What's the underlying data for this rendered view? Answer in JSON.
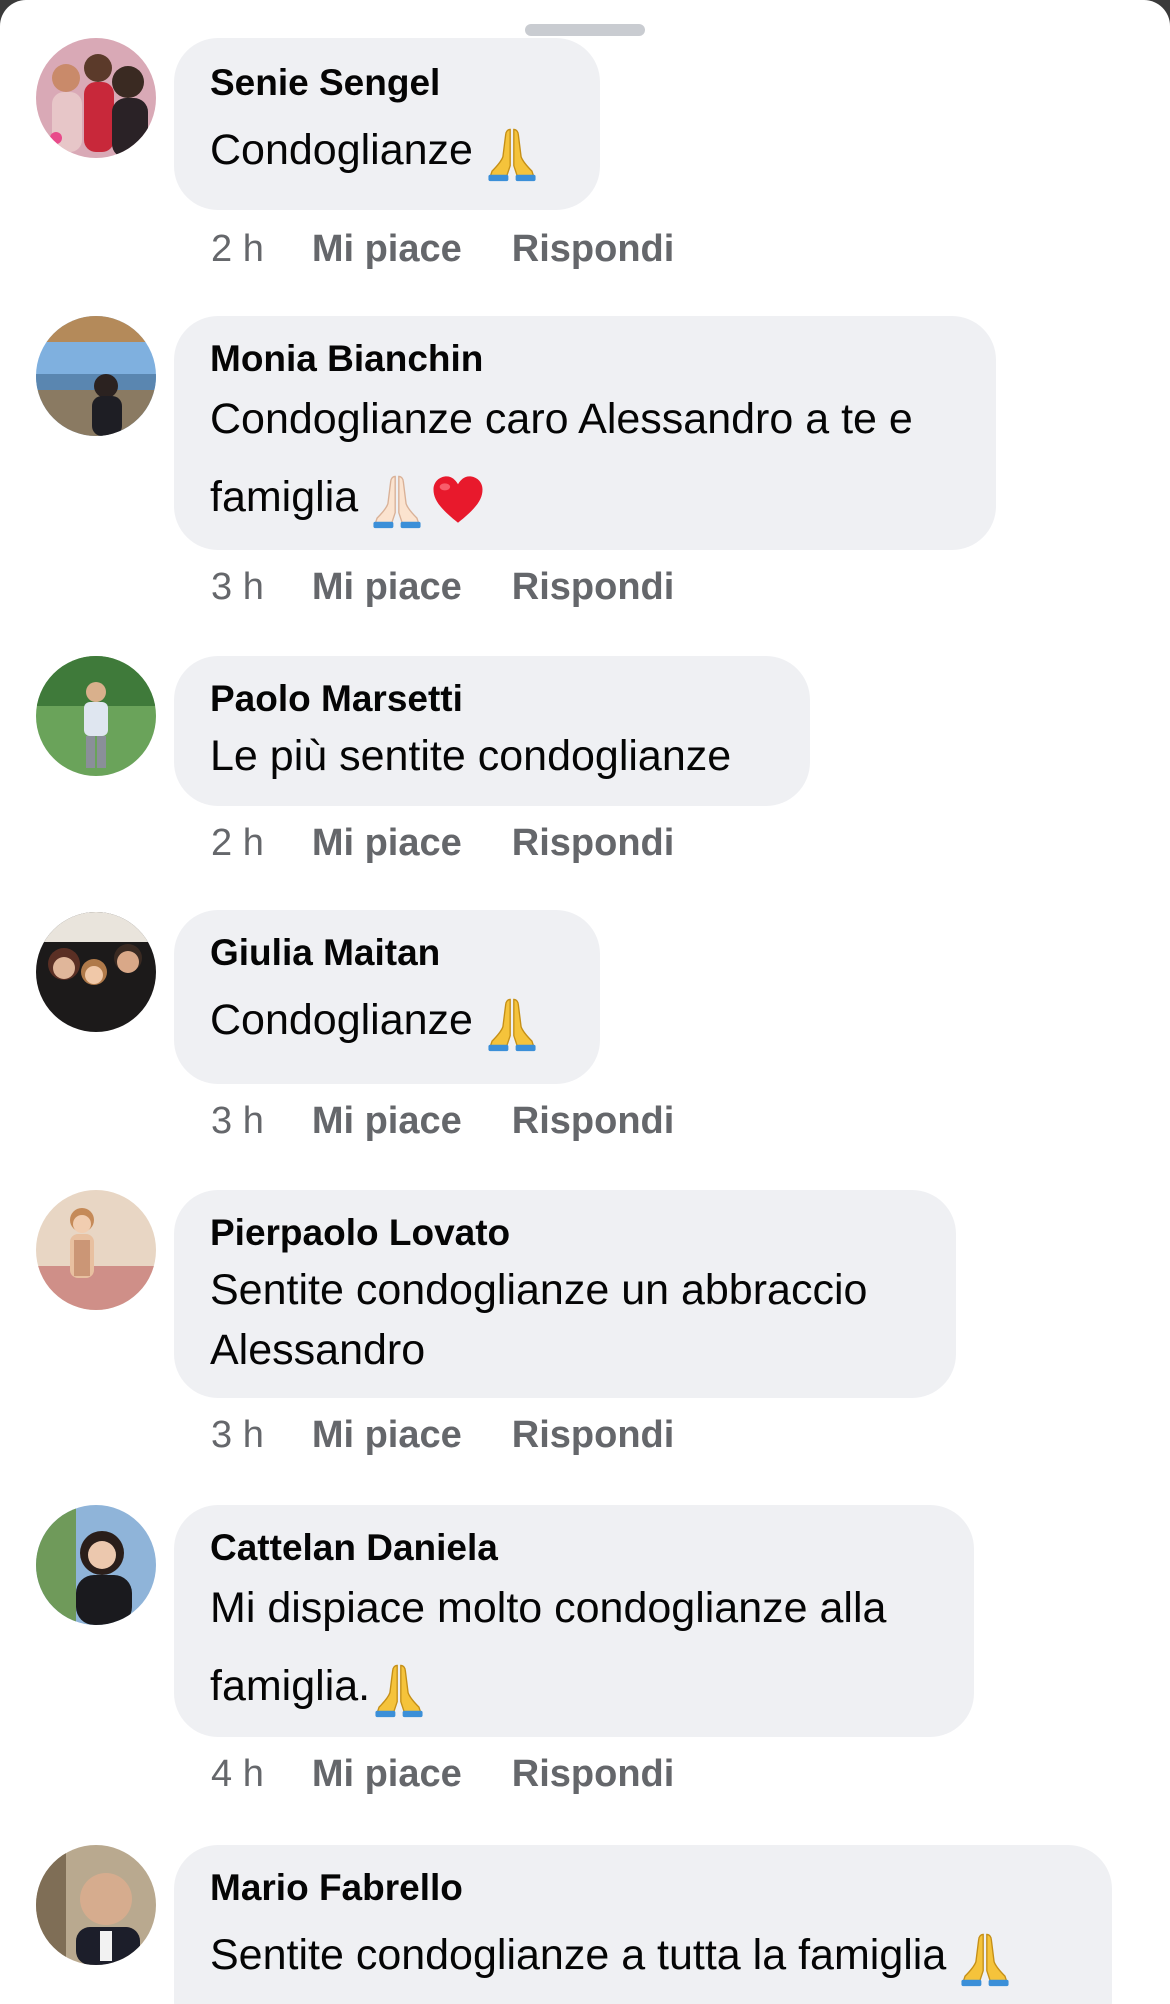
{
  "comments": [
    {
      "author": "Senie Sengel",
      "text": "Condoglianze",
      "emojis": [
        "folded-hands-icon"
      ],
      "time": "2 h",
      "like_label": "Mi piace",
      "reply_label": "Rispondi"
    },
    {
      "author": "Monia Bianchin",
      "text": "Condoglianze caro Alessandro a te e famiglia",
      "emojis": [
        "folded-hands-light-icon",
        "red-heart-icon"
      ],
      "time": "3 h",
      "like_label": "Mi piace",
      "reply_label": "Rispondi"
    },
    {
      "author": "Paolo Marsetti",
      "text": "Le più sentite condoglianze",
      "emojis": [],
      "time": "2 h",
      "like_label": "Mi piace",
      "reply_label": "Rispondi"
    },
    {
      "author": "Giulia Maitan",
      "text": "Condoglianze",
      "emojis": [
        "folded-hands-icon"
      ],
      "time": "3 h",
      "like_label": "Mi piace",
      "reply_label": "Rispondi"
    },
    {
      "author": "Pierpaolo Lovato",
      "text": "Sentite condoglianze un abbraccio Alessandro",
      "emojis": [],
      "time": "3 h",
      "like_label": "Mi piace",
      "reply_label": "Rispondi"
    },
    {
      "author": "Cattelan Daniela",
      "text": "Mi dispiace molto condoglianze alla famiglia.",
      "emojis": [
        "folded-hands-icon"
      ],
      "time": "4 h",
      "like_label": "Mi piace",
      "reply_label": "Rispondi"
    },
    {
      "author": "Mario Fabrello",
      "text": "Sentite condoglianze a tutta la famiglia",
      "emojis": [
        "folded-hands-icon"
      ],
      "time": "",
      "like_label": "",
      "reply_label": ""
    }
  ],
  "colors": {
    "bubble_bg": "#eff0f3",
    "meta_text": "#65676b",
    "primary_text": "#050505",
    "grabber": "#c9ccd1"
  }
}
